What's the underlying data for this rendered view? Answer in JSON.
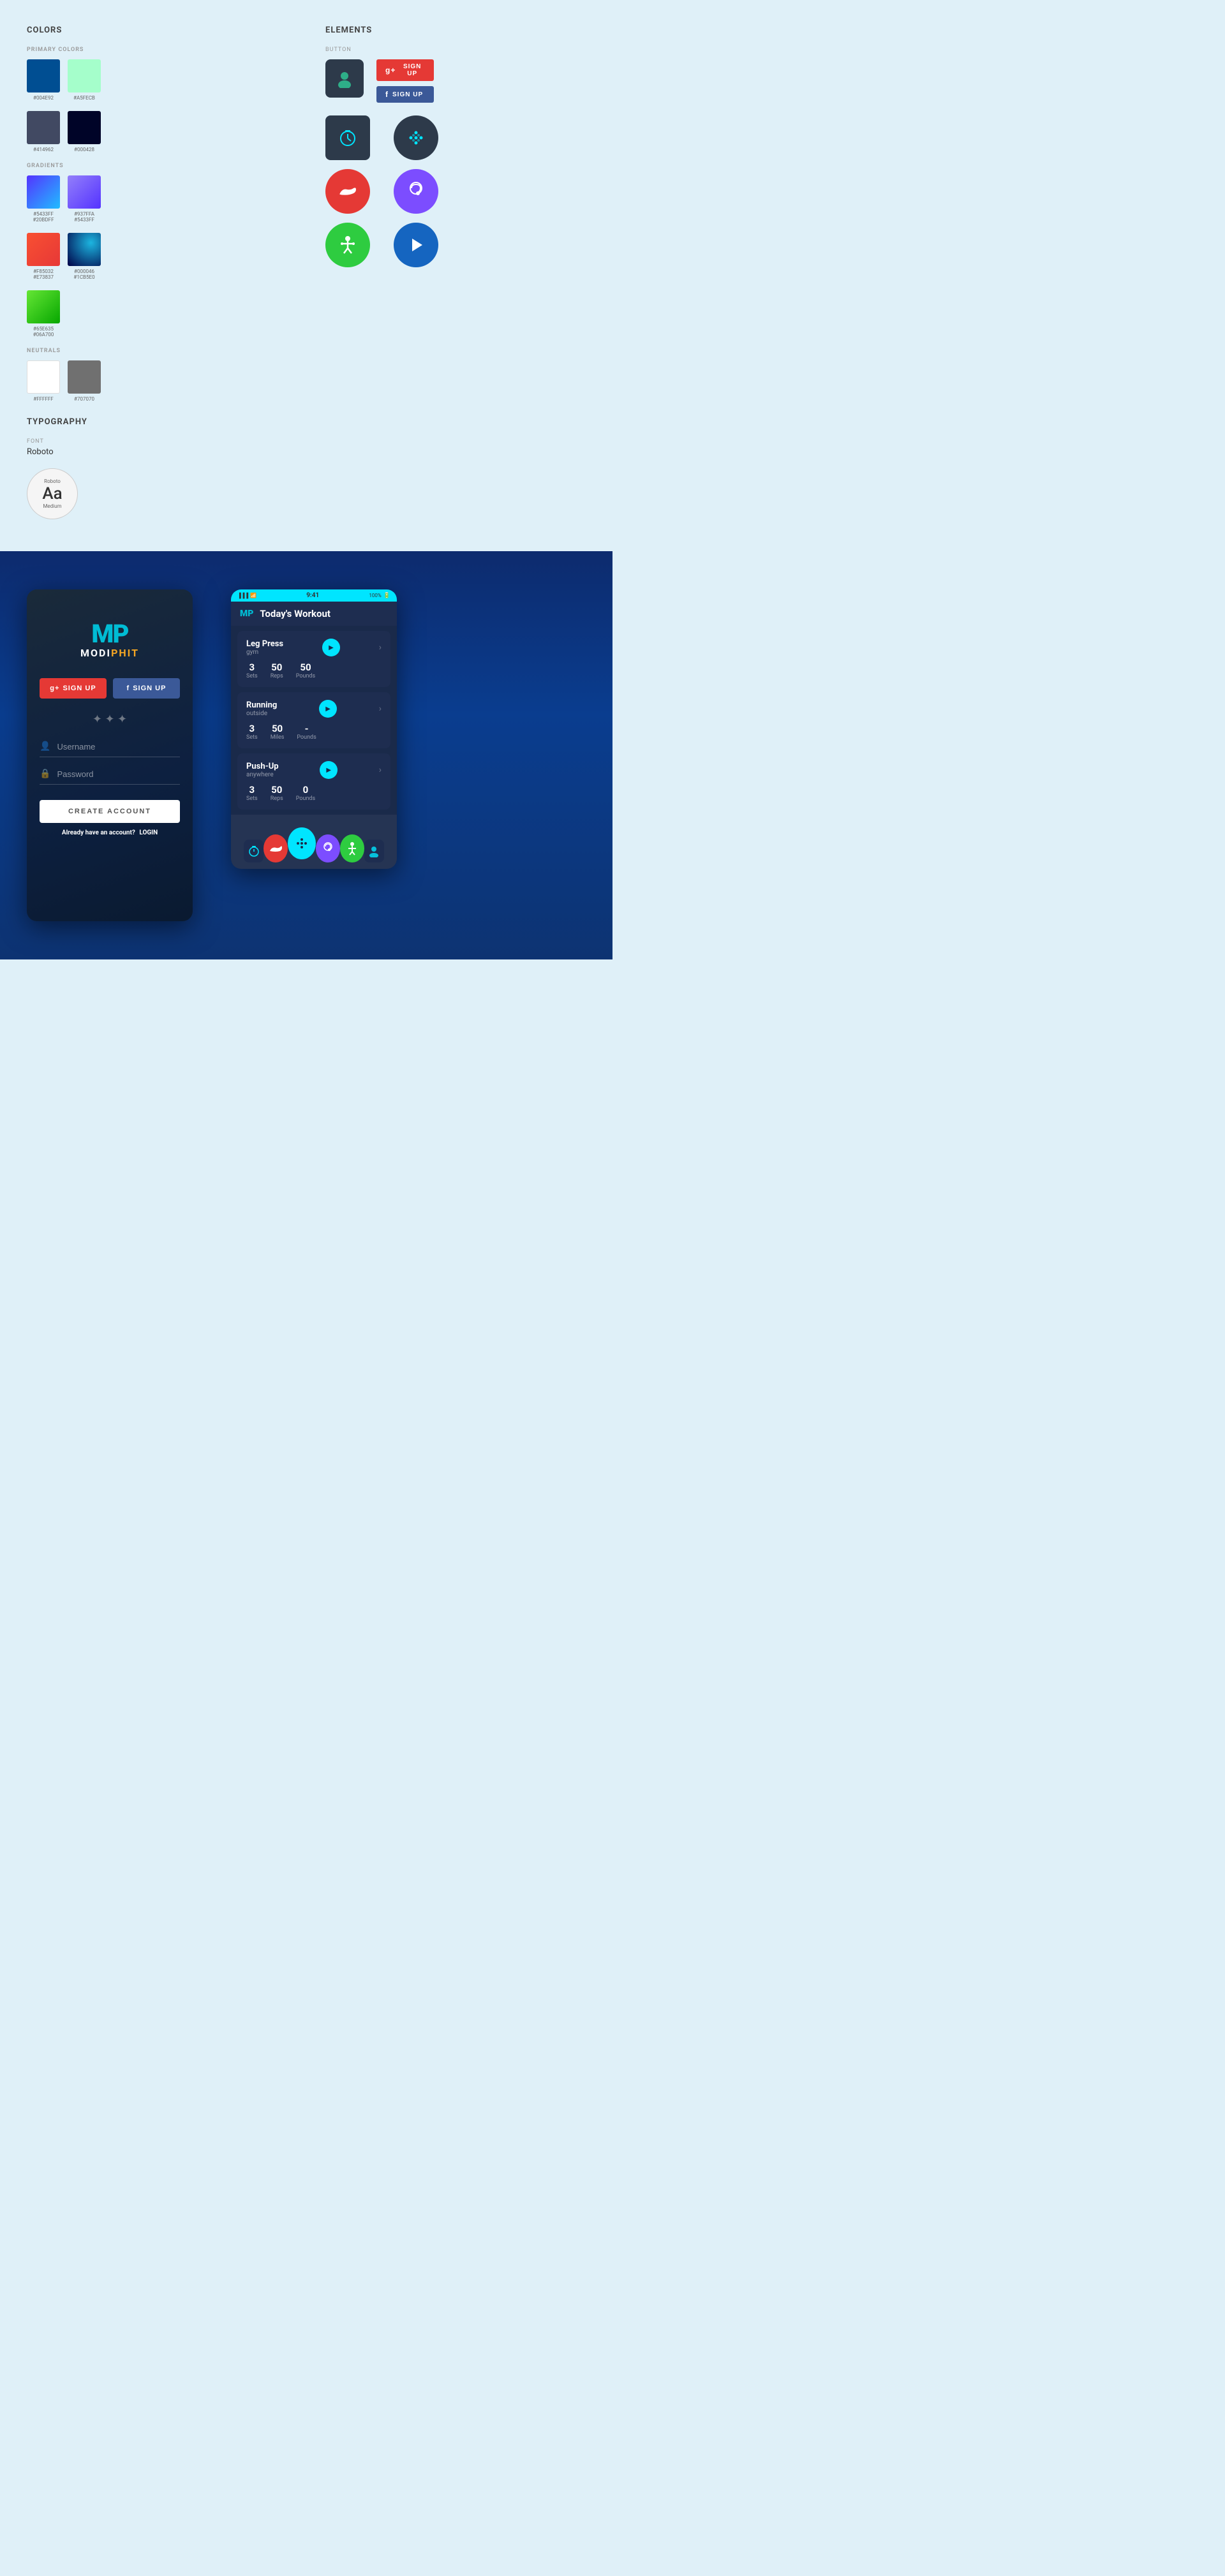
{
  "spec": {
    "colors_title": "COLORS",
    "primary_colors_title": "PRIMARY COLORS",
    "gradients_title": "GRADIENTS",
    "neutrals_title": "NEUTRALS",
    "primary_colors": [
      {
        "hex": "#004E92",
        "swatch": "#004E92"
      },
      {
        "hex": "#A5FECB",
        "swatch": "#A5FECB"
      }
    ],
    "dark_colors": [
      {
        "hex": "#414962",
        "swatch": "#414962"
      },
      {
        "hex": "#000428",
        "swatch": "#000428"
      }
    ],
    "gradients": [
      {
        "hex1": "#5433FF",
        "hex2": "#20BDFF",
        "label": "#5433FF\n#20BDFF"
      },
      {
        "hex1": "#937FFA",
        "hex2": "#5433FF",
        "label": "#937FFA\n#5433FF"
      },
      {
        "hex1": "#F85032",
        "hex2": "#E73837",
        "label": "#F85032\n#E73837"
      },
      {
        "hex1": "#000046",
        "hex2": "#1CB5E0",
        "label": "#000046\n#1CB5E0"
      },
      {
        "hex1": "#65E635",
        "hex2": "#06A700",
        "label": "#65E635\n#06A700"
      }
    ],
    "neutrals": [
      {
        "hex": "#FFFFFF",
        "swatch": "#FFFFFF"
      },
      {
        "hex": "#707070",
        "swatch": "#707070"
      }
    ],
    "typography_title": "TYPOGRAPHY",
    "font_label": "FONT",
    "font_name": "Roboto",
    "font_sample_name": "Roboto",
    "font_sample_aa": "Aa",
    "font_sample_weight": "Medium",
    "elements_title": "ELEMENTS",
    "button_label": "BUTTON",
    "btn_google_label": "SIGN UP",
    "btn_facebook_label": "SIGN UP"
  },
  "login_screen": {
    "logo_mp": "MP",
    "logo_modi": "MODI",
    "logo_phit": "PHIT",
    "btn_google": "SIGN UP",
    "btn_facebook": "SIGN UP",
    "username_placeholder": "Username",
    "password_placeholder": "Password",
    "create_account": "CREATE ACCOUNT",
    "already_account": "Already have an account?",
    "login_link": "LOGIN"
  },
  "workout_screen": {
    "status_time": "9:41",
    "status_battery": "100%",
    "title": "Today's Workout",
    "exercises": [
      {
        "name": "Leg Press",
        "location": "gym",
        "sets": "3",
        "sets_label": "Sets",
        "val2": "50",
        "label2": "Reps",
        "val3": "50",
        "label3": "Pounds"
      },
      {
        "name": "Running",
        "location": "outside",
        "sets": "3",
        "sets_label": "Sets",
        "val2": "50",
        "label2": "Miles",
        "val3": "-",
        "label3": "Pounds"
      },
      {
        "name": "Push-Up",
        "location": "anywhere",
        "sets": "3",
        "sets_label": "Sets",
        "val2": "50",
        "label2": "Reps",
        "val3": "0",
        "label3": "Pounds"
      }
    ]
  }
}
